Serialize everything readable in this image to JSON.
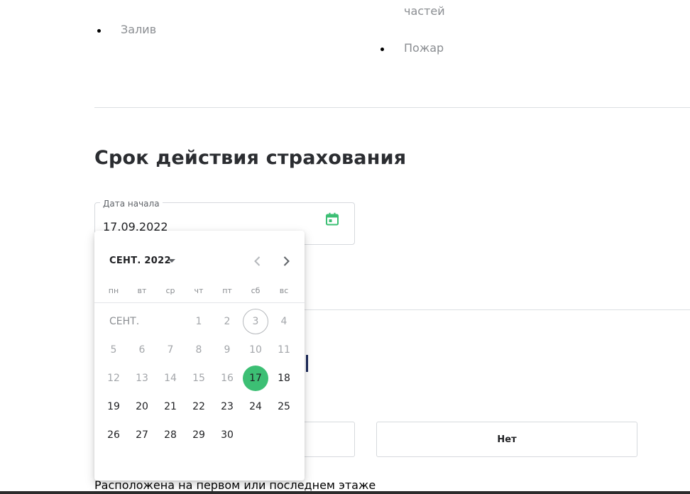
{
  "risks": {
    "col1_item": "Залив",
    "col2_fragment": "частей",
    "col2_item": "Пожар"
  },
  "insurance_period": {
    "title": "Срок действия страхования",
    "start_date_label": "Дата начала",
    "start_date_value": "17.09.2022"
  },
  "calendar": {
    "month_year": "СЕНТ. 2022",
    "month_short": "СЕНТ.",
    "weekdays": [
      "пн",
      "вт",
      "ср",
      "чт",
      "пт",
      "сб",
      "вс"
    ],
    "first_weekday_index": 3,
    "days_in_month": 30,
    "today": 3,
    "selected": 17,
    "min_enabled_day": 17
  },
  "question": {
    "no_label": "Нет",
    "text": "Расположена на первом или последнем этаже"
  },
  "colors": {
    "accent_green": "#3cbf74",
    "text_muted": "#8a8d91"
  },
  "icons": {
    "calendar": "calendar-icon",
    "caret": "caret-down-icon",
    "prev": "chevron-left-icon",
    "next": "chevron-right-icon"
  }
}
